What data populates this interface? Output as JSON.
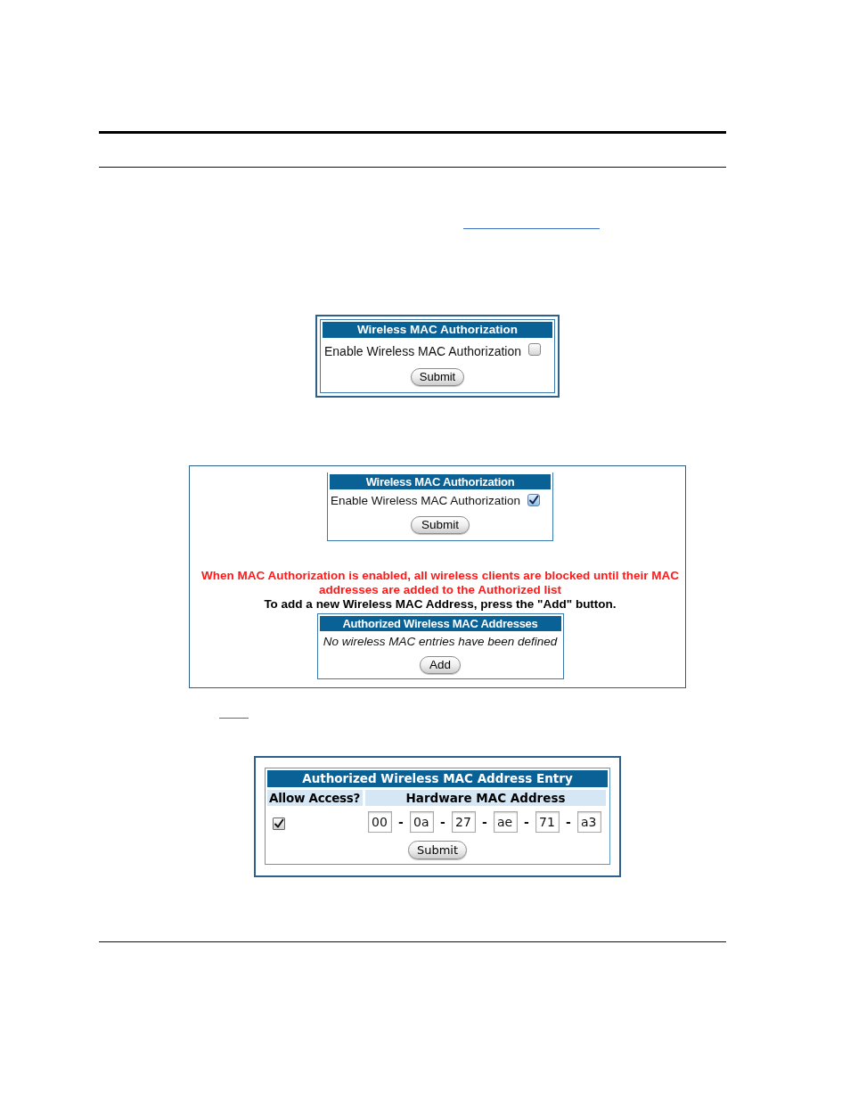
{
  "figure_1": {
    "title": "Wireless MAC Authorization",
    "checkbox": {
      "label": "Enable Wireless MAC Authorization",
      "checked": false
    },
    "button": "Submit"
  },
  "figure_2": {
    "form": {
      "title": "Wireless MAC Authorization",
      "checkbox": {
        "label": "Enable Wireless MAC Authorization",
        "checked": true
      },
      "button": "Submit"
    },
    "warning": "When MAC Authorization is enabled, all wireless clients are blocked until their MAC addresses are added to the Authorized list",
    "instruction": "To add a new Wireless MAC Address, press the \"Add\" button.",
    "list": {
      "title": "Authorized Wireless MAC Addresses",
      "empty_message": "No wireless MAC entries have been defined",
      "button": "Add"
    }
  },
  "figure_3": {
    "title": "Authorized Wireless MAC Address Entry",
    "columns": [
      "Allow Access?",
      "Hardware MAC Address"
    ],
    "allow_access": {
      "checked": true
    },
    "mac_address": [
      "00",
      "0a",
      "27",
      "ae",
      "71",
      "a3"
    ],
    "separators": [
      "-",
      "-",
      "-",
      "-",
      "-"
    ],
    "button": "Submit"
  }
}
